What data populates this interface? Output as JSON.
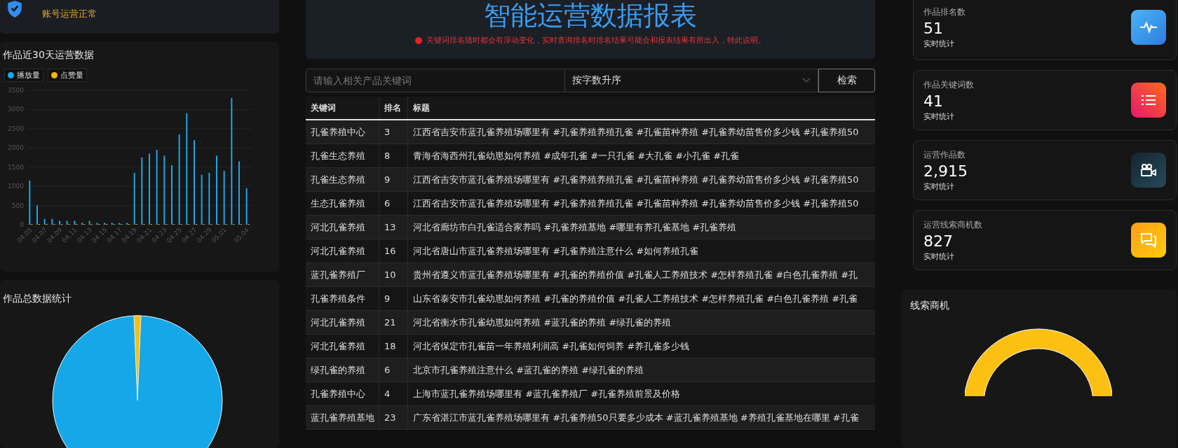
{
  "account": {
    "status": "账号运营正常"
  },
  "trend_panel": {
    "title": "作品近30天运营数据",
    "chart_data": {
      "type": "bar",
      "grid": true,
      "categories": [
        "04.05",
        null,
        "04.07",
        null,
        "04.09",
        null,
        "04.11",
        null,
        "04.13",
        null,
        "04.15",
        null,
        "04.17",
        null,
        "04.19",
        null,
        "04.21",
        null,
        "04.23",
        null,
        "04.25",
        null,
        "04.27",
        null,
        "04.29",
        null,
        "05.01",
        null,
        null,
        "05.04"
      ],
      "ylim": [
        0,
        3500
      ],
      "yticks": [
        0,
        500,
        1000,
        1500,
        2000,
        2500,
        3000,
        3500
      ],
      "series": [
        {
          "name": "播放量",
          "color": "#1aa6e8",
          "values": [
            1150,
            500,
            150,
            150,
            100,
            100,
            100,
            50,
            100,
            50,
            50,
            50,
            50,
            50,
            1350,
            1750,
            1850,
            1950,
            1800,
            1550,
            2350,
            2900,
            2200,
            1300,
            1350,
            1800,
            1400,
            3300,
            1650,
            950
          ]
        },
        {
          "name": "点赞量",
          "color": "#f5b50a",
          "values": [
            0,
            0,
            0,
            0,
            0,
            0,
            0,
            0,
            0,
            0,
            0,
            0,
            0,
            0,
            0,
            0,
            0,
            0,
            0,
            0,
            0,
            0,
            0,
            0,
            0,
            0,
            0,
            0,
            0,
            0
          ]
        }
      ]
    }
  },
  "pie_panel": {
    "title": "作品总数据统计"
  },
  "header": {
    "title": "智能运营数据报表",
    "notice": "关键词排名随时都会有浮动变化，实时查询排名时排名结果可能会和报表结果有所出入，特此说明。"
  },
  "search": {
    "placeholder": "请输入相关产品关键词",
    "sort": "按字数升序",
    "button": "检索"
  },
  "table": {
    "columns": [
      "关键词",
      "排名",
      "标题"
    ],
    "rows": [
      [
        "孔雀养殖中心",
        "3",
        "江西省吉安市蓝孔雀养殖场哪里有 #孔雀养殖养殖孔雀 #孔雀苗种养殖 #孔雀养幼苗售价多少钱 #孔雀养殖50"
      ],
      [
        "孔雀生态养殖",
        "8",
        "青海省海西州孔雀幼崽如何养殖 #成年孔雀 #一只孔雀 #大孔雀 #小孔雀 #孔雀"
      ],
      [
        "孔雀生态养殖",
        "9",
        "江西省吉安市蓝孔雀养殖场哪里有 #孔雀养殖养殖孔雀 #孔雀苗种养殖 #孔雀养幼苗售价多少钱 #孔雀养殖50"
      ],
      [
        "生态孔雀养殖",
        "6",
        "江西省吉安市蓝孔雀养殖场哪里有 #孔雀养殖养殖孔雀 #孔雀苗种养殖 #孔雀养幼苗售价多少钱 #孔雀养殖50"
      ],
      [
        "河北孔雀养殖",
        "13",
        "河北省廊坊市白孔雀适合家养吗 #孔雀养殖基地 #哪里有养孔雀基地 #孔雀养殖"
      ],
      [
        "河北孔雀养殖",
        "16",
        "河北省唐山市蓝孔雀养殖场哪里有 #孔雀养殖注意什么 #如何养殖孔雀"
      ],
      [
        "蓝孔雀养殖厂",
        "10",
        "贵州省遵义市蓝孔雀养殖场哪里有 #孔雀的养殖价值 #孔雀人工养殖技术 #怎样养殖孔雀 #白色孔雀养殖 #孔"
      ],
      [
        "孔雀养殖条件",
        "9",
        "山东省泰安市孔雀幼崽如何养殖 #孔雀的养殖价值 #孔雀人工养殖技术 #怎样养殖孔雀 #白色孔雀养殖 #孔雀"
      ],
      [
        "河北孔雀养殖",
        "21",
        "河北省衡水市孔雀幼崽如何养殖 #蓝孔雀的养殖 #绿孔雀的养殖"
      ],
      [
        "河北孔雀养殖",
        "18",
        "河北省保定市孔雀苗一年养殖利润高 #孔雀如何饲养 #养孔雀多少钱"
      ],
      [
        "绿孔雀的养殖",
        "6",
        "北京市孔雀养殖注意什么 #蓝孔雀的养殖 #绿孔雀的养殖"
      ],
      [
        "孔雀养殖中心",
        "4",
        "上海市蓝孔雀养殖场哪里有 #蓝孔雀养殖厂 #孔雀养殖前景及价格"
      ],
      [
        "蓝孔雀养殖基地",
        "23",
        "广东省湛江市蓝孔雀养殖场哪里有 #孔雀养殖50只要多少成本 #蓝孔雀养殖基地 #养殖孔雀基地在哪里 #孔雀"
      ]
    ]
  },
  "stats": [
    {
      "kind": "pulse",
      "label": "作品排名数",
      "value": "51",
      "note": "实时统计"
    },
    {
      "kind": "list",
      "label": "作品关键词数",
      "value": "41",
      "note": "实时统计"
    },
    {
      "kind": "video",
      "label": "运营作品数",
      "value": "2,915",
      "note": "实时统计"
    },
    {
      "kind": "chat",
      "label": "运营线索商机数",
      "value": "827",
      "note": "实时统计"
    }
  ],
  "leads_panel": {
    "title": "线索商机"
  }
}
